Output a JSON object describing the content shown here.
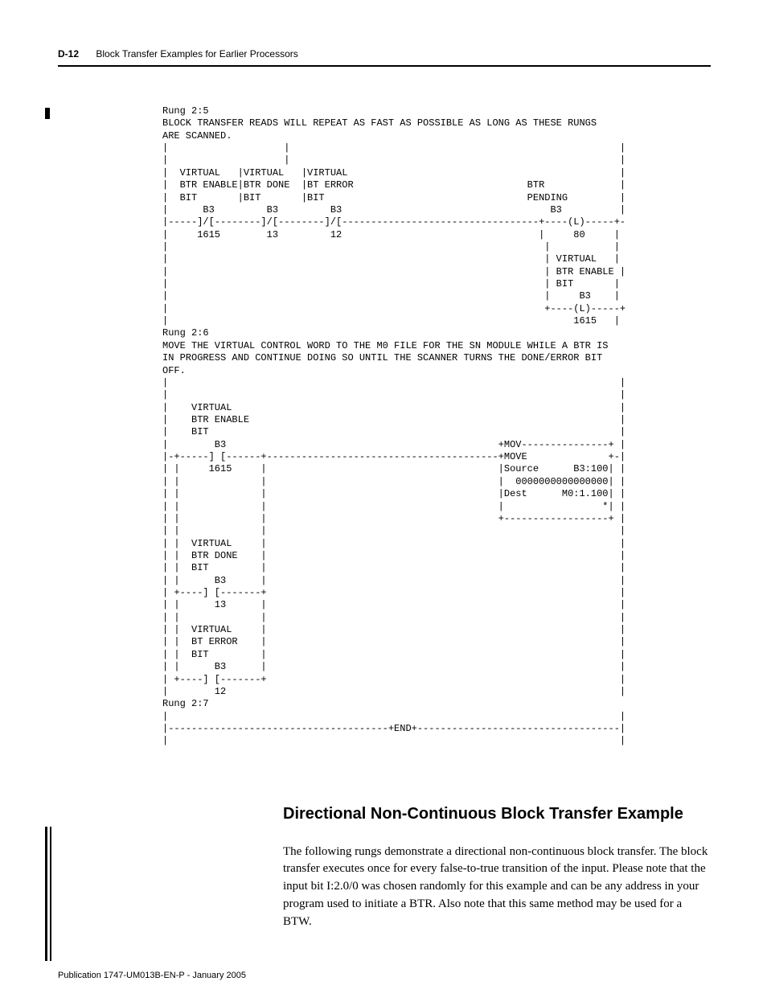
{
  "header": {
    "page_number": "D-12",
    "chapter_title": "Block Transfer Examples for Earlier Processors"
  },
  "code_block": "Rung 2:5\nBLOCK TRANSFER READS WILL REPEAT AS FAST AS POSSIBLE AS LONG AS THESE RUNGS\nARE SCANNED.\n|                    |                                                         |\n|                    |                                                         |\n|  VIRTUAL   |VIRTUAL   |VIRTUAL                                               |\n|  BTR ENABLE|BTR DONE  |BT ERROR                              BTR             |\n|  BIT       |BIT       |BIT                                   PENDING         |\n|      B3         B3         B3                                    B3          |\n|-----]/[--------]/[--------]/[----------------------------------+----(L)-----+-\n|     1615        13         12                                  |     80     |\n|                                                                 |           |\n|                                                                 | VIRTUAL   |\n|                                                                 | BTR ENABLE |\n|                                                                 | BIT       |\n|                                                                 |     B3    |\n|                                                                 +----(L)-----+\n|                                                                      1615   |\nRung 2:6\nMOVE THE VIRTUAL CONTROL WORD TO THE M0 FILE FOR THE SN MODULE WHILE A BTR IS\nIN PROGRESS AND CONTINUE DOING SO UNTIL THE SCANNER TURNS THE DONE/ERROR BIT\nOFF.\n|                                                                              |\n|                                                                              |\n|    VIRTUAL                                                                   |\n|    BTR ENABLE                                                                |\n|    BIT                                                                       |\n|        B3                                               +MOV---------------+ |\n|-+-----] [------+----------------------------------------+MOVE              +-|\n| |     1615     |                                        |Source      B3:100| |\n| |              |                                        |  0000000000000000| |\n| |              |                                        |Dest      M0:1.100| |\n| |              |                                        |                 *| |\n| |              |                                        +------------------+ |\n| |              |                                                             |\n| |  VIRTUAL     |                                                             |\n| |  BTR DONE    |                                                             |\n| |  BIT         |                                                             |\n| |      B3      |                                                             |\n| +----] [-------+                                                             |\n| |      13      |                                                             |\n| |              |                                                             |\n| |  VIRTUAL     |                                                             |\n| |  BT ERROR    |                                                             |\n| |  BIT         |                                                             |\n| |      B3      |                                                             |\n| +----] [-------+                                                             |\n|        12                                                                    |\nRung 2:7\n|                                                                              |\n|--------------------------------------+END+-----------------------------------|\n|                                                                              |",
  "section": {
    "heading": "Directional Non-Continuous Block Transfer Example",
    "body": "The following rungs demonstrate a directional non-continuous block transfer. The block transfer executes once for every false-to-true transition of the input. Please note that the input bit I:2.0/0 was chosen randomly for this example and can be any address in your program used to initiate a BTR. Also note that this same method may be used for a BTW."
  },
  "footer": {
    "publication": "Publication 1747-UM013B-EN-P - January 2005"
  }
}
